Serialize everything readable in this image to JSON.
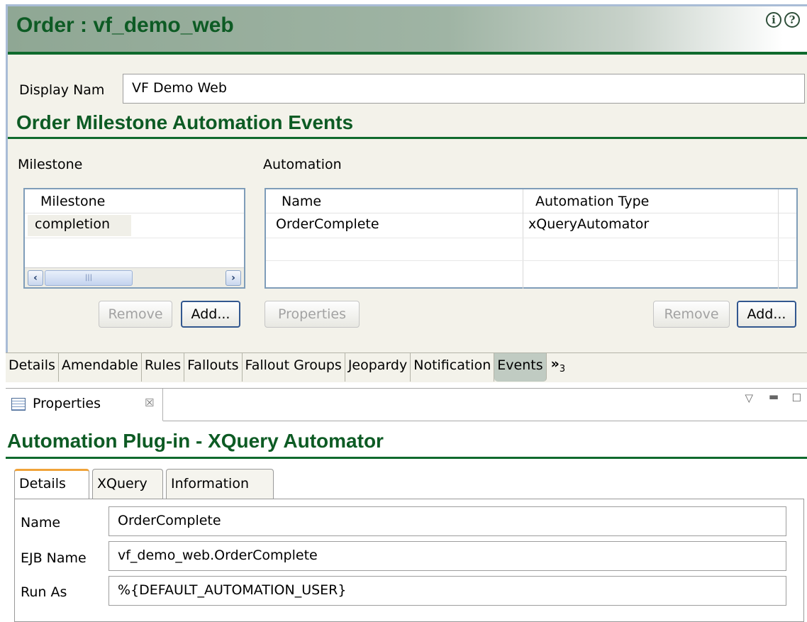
{
  "editor": {
    "title": "Order : vf_demo_web",
    "header_icons": [
      "info-icon",
      "help-icon"
    ],
    "display_name_label": "Display Nam",
    "display_name_value": "VF Demo Web",
    "section_title": "Order Milestone Automation Events",
    "milestone_label": "Milestone",
    "automation_label": "Automation",
    "milestone_table": {
      "columns": [
        "Milestone"
      ],
      "rows": [
        [
          "completion"
        ]
      ]
    },
    "automation_table": {
      "columns": [
        "Name",
        "Automation Type"
      ],
      "rows": [
        [
          "OrderComplete",
          "xQueryAutomator"
        ]
      ]
    },
    "buttons": {
      "milestone_remove": "Remove",
      "milestone_add": "Add...",
      "properties": "Properties",
      "automation_remove": "Remove",
      "automation_add": "Add..."
    },
    "tabs": [
      "Details",
      "Amendable",
      "Rules",
      "Fallouts",
      "Fallout Groups",
      "Jeopardy",
      "Notification",
      "Events"
    ],
    "active_tab": "Events",
    "overflow_marker": "»",
    "overflow_count": "3"
  },
  "properties_view": {
    "view_tab_label": "Properties",
    "view_tab_close": "☒",
    "title": "Automation Plug-in - XQuery Automator",
    "tabs": [
      "Details",
      "XQuery",
      "Information"
    ],
    "active_tab": "Details",
    "fields": {
      "name_label": "Name",
      "name_value": "OrderComplete",
      "ejb_label": "EJB Name",
      "ejb_value": "vf_demo_web.OrderComplete",
      "runas_label": "Run As",
      "runas_value": "%{DEFAULT_AUTOMATION_USER}"
    }
  },
  "colors": {
    "title_green": "#0d5b24",
    "header_gradient_start": "#8fa794",
    "active_tab_bg": "#c0cbc2",
    "active_ptab_accent": "#f0a33a"
  }
}
